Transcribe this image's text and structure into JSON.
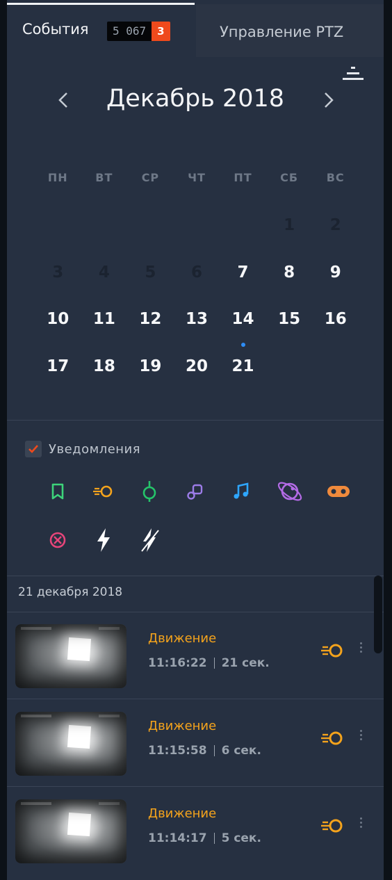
{
  "tabs": {
    "events_label": "События",
    "events_total": "5 067",
    "events_new": "3",
    "ptz_label": "Управление PTZ"
  },
  "calendar": {
    "title": "Декабрь 2018",
    "weekdays": [
      "ПН",
      "ВТ",
      "СР",
      "ЧТ",
      "ПТ",
      "СБ",
      "ВС"
    ],
    "days": [
      {
        "n": "",
        "state": "empty"
      },
      {
        "n": "",
        "state": "empty"
      },
      {
        "n": "",
        "state": "empty"
      },
      {
        "n": "",
        "state": "empty"
      },
      {
        "n": "",
        "state": "empty"
      },
      {
        "n": "1",
        "state": "muted"
      },
      {
        "n": "2",
        "state": "muted"
      },
      {
        "n": "3",
        "state": "muted"
      },
      {
        "n": "4",
        "state": "muted"
      },
      {
        "n": "5",
        "state": "muted"
      },
      {
        "n": "6",
        "state": "muted"
      },
      {
        "n": "7",
        "state": "active"
      },
      {
        "n": "8",
        "state": "active"
      },
      {
        "n": "9",
        "state": "active"
      },
      {
        "n": "10",
        "state": "active"
      },
      {
        "n": "11",
        "state": "active"
      },
      {
        "n": "12",
        "state": "active"
      },
      {
        "n": "13",
        "state": "active"
      },
      {
        "n": "14",
        "state": "active"
      },
      {
        "n": "15",
        "state": "active"
      },
      {
        "n": "16",
        "state": "active"
      },
      {
        "n": "17",
        "state": "active"
      },
      {
        "n": "18",
        "state": "active"
      },
      {
        "n": "19",
        "state": "active"
      },
      {
        "n": "20",
        "state": "active"
      },
      {
        "n": "21",
        "state": "active",
        "dot": true
      }
    ]
  },
  "notifications": {
    "label": "Уведомления",
    "checked": true,
    "filter_icons": [
      {
        "name": "bookmark-icon",
        "color": "#3dd37a"
      },
      {
        "name": "motion-icon",
        "color": "#f4a31c"
      },
      {
        "name": "line-cross-icon",
        "color": "#25c46a"
      },
      {
        "name": "object-icon",
        "color": "#9c7ce8"
      },
      {
        "name": "music-note-icon",
        "color": "#2ea6ff"
      },
      {
        "name": "orbit-icon",
        "color": "#b46be6"
      },
      {
        "name": "toggle-icon",
        "color": "#f08a3c"
      },
      {
        "name": "cancel-circle-icon",
        "color": "#e6457a"
      },
      {
        "name": "lightning-icon",
        "color": "#ffffff"
      },
      {
        "name": "lightning-off-icon",
        "color": "#ffffff"
      }
    ]
  },
  "events": {
    "date_header": "21 декабря 2018",
    "items": [
      {
        "type": "Движение",
        "time": "11:16:22",
        "duration": "21 сек."
      },
      {
        "type": "Движение",
        "time": "11:15:58",
        "duration": "6 сек."
      },
      {
        "type": "Движение",
        "time": "11:14:17",
        "duration": "5 сек."
      }
    ]
  },
  "colors": {
    "panel_bg": "#263041",
    "accent_orange": "#ef4a1c",
    "event_type": "#f4a31c",
    "today_dot": "#2e8df5"
  }
}
